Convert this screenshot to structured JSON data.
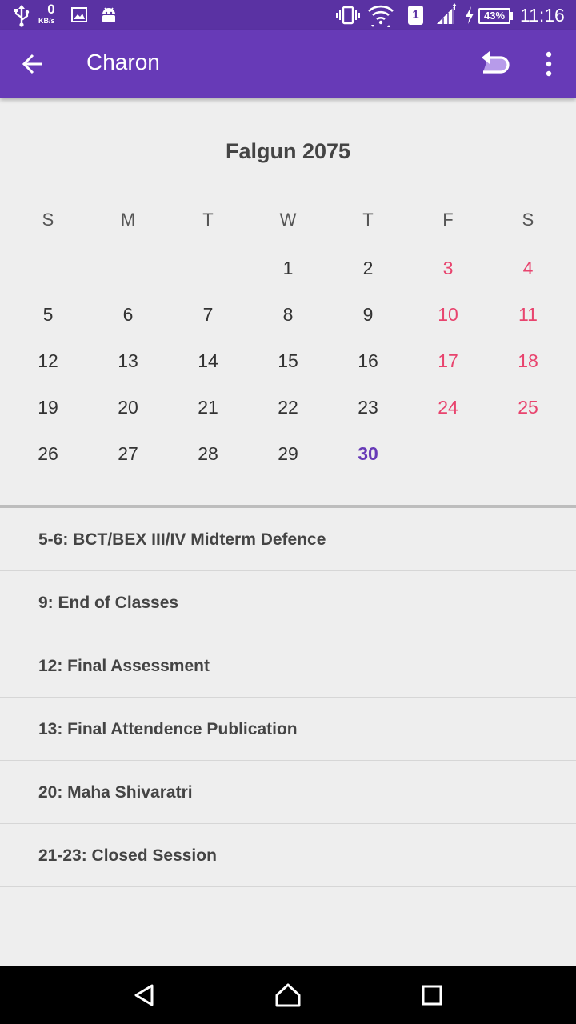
{
  "status_bar": {
    "kbs_value": "0",
    "kbs_unit": "KB/s",
    "sim_slot": "1",
    "battery": "43%",
    "time": "11:16",
    "icons": [
      "usb-icon",
      "image-icon",
      "android-icon",
      "vibrate-icon",
      "wifi-icon",
      "signal-icon",
      "charging-icon",
      "battery-icon"
    ]
  },
  "toolbar": {
    "title": "Charon",
    "icons": [
      "back-arrow-icon",
      "undo-icon",
      "overflow-menu-icon"
    ]
  },
  "calendar": {
    "month_title": "Falgun 2075",
    "weekdays": [
      "S",
      "M",
      "T",
      "W",
      "T",
      "F",
      "S"
    ],
    "leading_blanks": 3,
    "days": [
      "1",
      "2",
      "3",
      "4",
      "5",
      "6",
      "7",
      "8",
      "9",
      "10",
      "11",
      "12",
      "13",
      "14",
      "15",
      "16",
      "17",
      "18",
      "19",
      "20",
      "21",
      "22",
      "23",
      "24",
      "25",
      "26",
      "27",
      "28",
      "29",
      "30"
    ],
    "highlighted_day": "30",
    "colors": {
      "weekend": "#E8446E",
      "highlight": "#673AB7",
      "normal": "#333333"
    }
  },
  "events": [
    "5-6: BCT/BEX III/IV Midterm Defence",
    "9: End of Classes",
    "12: Final Assessment",
    "13: Final Attendence Publication",
    "20: Maha Shivaratri",
    "21-23: Closed Session"
  ],
  "nav_bar": {
    "icons": [
      "back-triangle-icon",
      "home-icon",
      "recents-icon"
    ]
  },
  "colors": {
    "primary": "#673AB7",
    "status_bar": "#5A32A3",
    "background": "#EEEEEE"
  }
}
